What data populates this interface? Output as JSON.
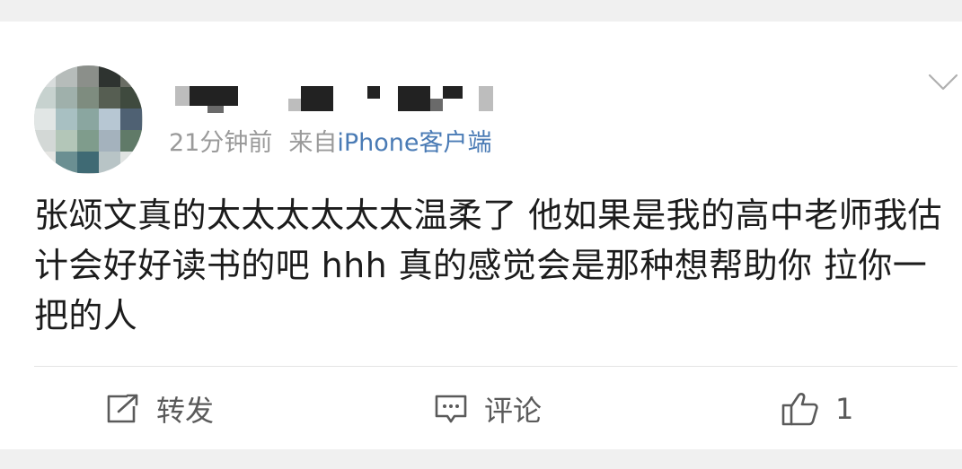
{
  "post": {
    "author": {
      "name_censored": true
    },
    "meta": {
      "time": "21分钟前",
      "from_label": "来自",
      "source": "iPhone客户端"
    },
    "text": "张颂文真的太太太太太太温柔了 他如果是我的高中老师我估计会好好读书的吧 hhh 真的感觉会是那种想帮助你 拉你一把的人"
  },
  "actions": {
    "repost_label": "转发",
    "comment_label": "评论",
    "like_count": "1"
  },
  "icons": {
    "menu": "chevron-down-icon",
    "repost": "repost-icon",
    "comment": "comment-icon",
    "like": "thumbs-up-icon"
  },
  "colors": {
    "source_link": "#4a7bb5",
    "meta_text": "#9a9a9a",
    "body_text": "#1c1c1c",
    "action_text": "#5a5a5a"
  }
}
